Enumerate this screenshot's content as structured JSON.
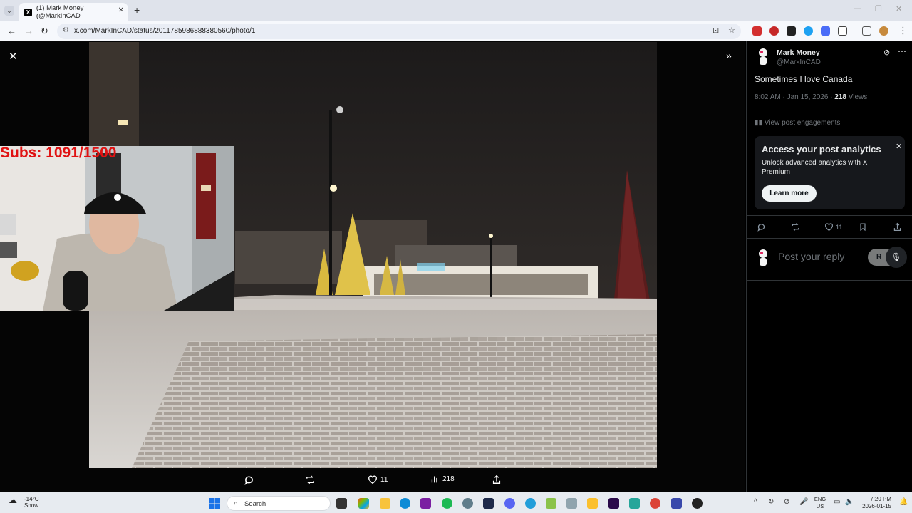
{
  "browser": {
    "tab_title": "(1) Mark Money (@MarkInCAD",
    "tab_favicon": "X",
    "url": "x.com/MarkInCAD/status/2011785986888380560/photo/1",
    "new_tab_icon": "+",
    "close_tab_icon": "✕"
  },
  "overlay": {
    "subs_text": "Subs: 1091/1500"
  },
  "viewer": {
    "close_icon": "✕",
    "expand_icon": "»",
    "likes": "11",
    "views": "218"
  },
  "post": {
    "author_name": "Mark Money",
    "author_handle": "@MarkInCAD",
    "text": "Sometimes I love Canada",
    "timestamp": "8:02 AM · Jan 15, 2026 · ",
    "views_count": "218",
    "views_label": " Views",
    "engagements_label": "View post engagements",
    "likes": "11"
  },
  "analytics_card": {
    "title": "Access your post analytics",
    "description": "Unlock advanced analytics with X Premium",
    "button_label": "Learn more",
    "close_icon": "✕"
  },
  "reply": {
    "placeholder": "Post your reply",
    "button_label": "R"
  },
  "taskbar": {
    "temperature": "-14°C",
    "weather": "Snow",
    "search_label": "Search",
    "lang_primary": "ENG",
    "lang_secondary": "US",
    "time": "7:20 PM",
    "date": "2026-01-15"
  },
  "colors": {
    "x_background": "#000000",
    "subs_red": "#e01212",
    "taskbar": "#e7ebf0"
  }
}
